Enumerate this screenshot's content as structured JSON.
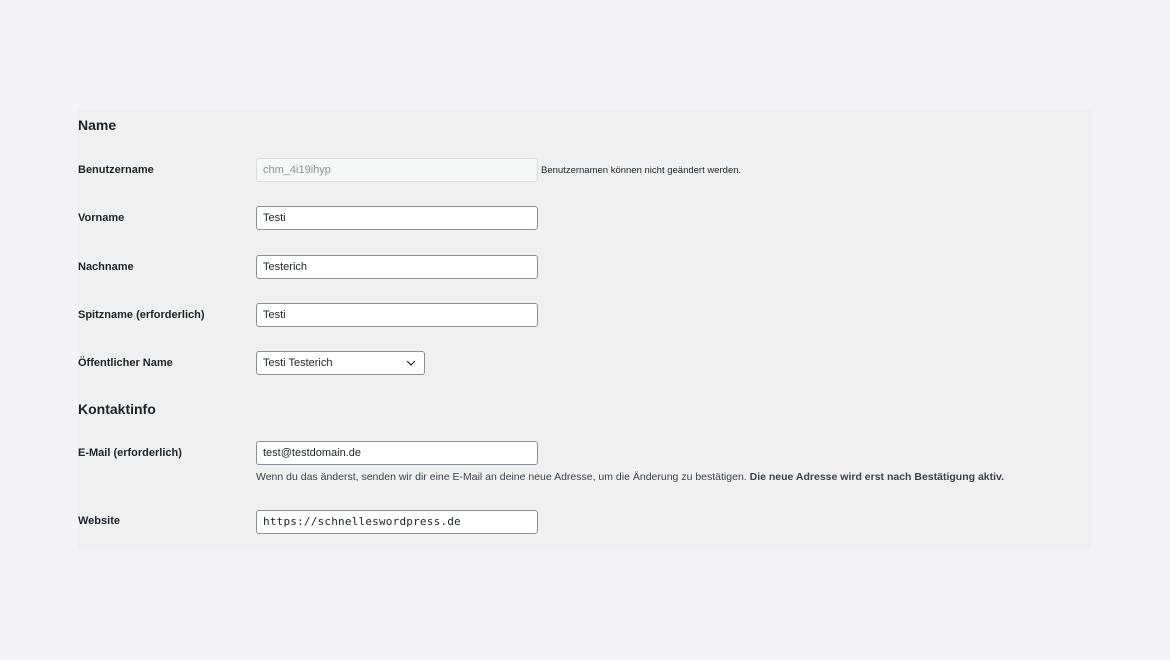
{
  "sections": {
    "name_title": "Name",
    "contact_title": "Kontaktinfo"
  },
  "fields": {
    "username": {
      "label": "Benutzername",
      "value": "chm_4i19ihyp",
      "description": "Benutzernamen können nicht geändert werden."
    },
    "first_name": {
      "label": "Vorname",
      "value": "Testi"
    },
    "last_name": {
      "label": "Nachname",
      "value": "Testerich"
    },
    "nickname": {
      "label": "Spitzname (erforderlich)",
      "value": "Testi"
    },
    "display_name": {
      "label": "Öffentlicher Name",
      "selected": "Testi Testerich"
    },
    "email": {
      "label": "E-Mail (erforderlich)",
      "value": "test@testdomain.de",
      "help_text": "Wenn du das änderst, senden wir dir eine E-Mail an deine neue Adresse, um die Änderung zu bestätigen. ",
      "help_bold": "Die neue Adresse wird erst nach Bestätigung aktiv."
    },
    "website": {
      "label": "Website",
      "value": "https://schnelleswordpress.de"
    }
  },
  "icons": {
    "select_arrow": "chevron-down-icon"
  }
}
